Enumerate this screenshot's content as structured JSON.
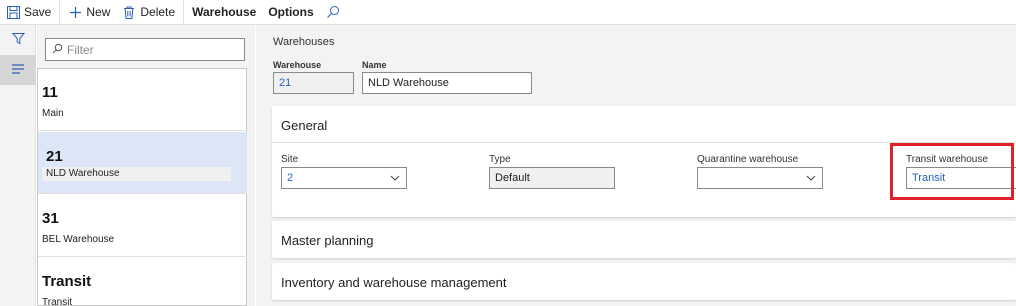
{
  "toolbar": {
    "save": "Save",
    "new": "New",
    "delete": "Delete",
    "warehouse": "Warehouse",
    "options": "Options"
  },
  "filter": {
    "placeholder": "Filter"
  },
  "list": [
    {
      "id": "11",
      "name": "Main"
    },
    {
      "id": "21",
      "name": "NLD Warehouse"
    },
    {
      "id": "31",
      "name": "BEL Warehouse"
    },
    {
      "id": "Transit",
      "name": "Transit"
    }
  ],
  "header": {
    "title": "Warehouses",
    "warehouse_label": "Warehouse",
    "warehouse_value": "21",
    "name_label": "Name",
    "name_value": "NLD Warehouse"
  },
  "general": {
    "title": "General",
    "site_label": "Site",
    "site_value": "2",
    "type_label": "Type",
    "type_value": "Default",
    "quarantine_label": "Quarantine warehouse",
    "quarantine_value": "",
    "transit_label": "Transit warehouse",
    "transit_value": "Transit"
  },
  "sections": {
    "master_planning": "Master planning",
    "inventory": "Inventory and warehouse management"
  },
  "colors": {
    "accent": "#2b5fb8",
    "selected": "#dce6f7",
    "highlight": "#e0202a"
  }
}
